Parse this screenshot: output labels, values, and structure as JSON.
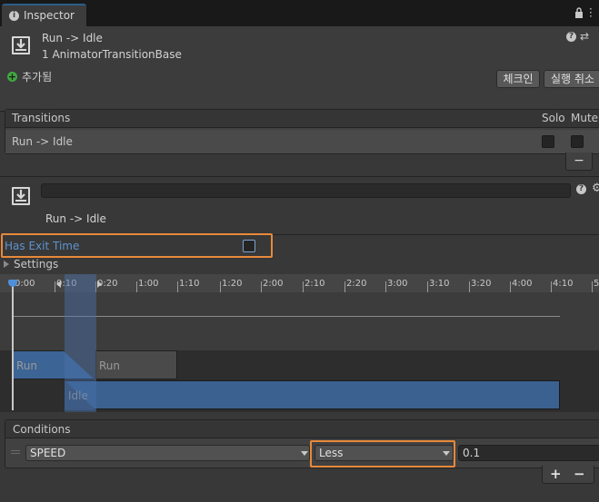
{
  "tab": {
    "label": "Inspector",
    "icon": "info-icon"
  },
  "header": {
    "title": "Run -> Idle",
    "subtitle": "1 AnimatorTransitionBase",
    "added_label": "추가됨",
    "checkin_label": "체크인",
    "revert_label": "실행 취소"
  },
  "transitions": {
    "title": "Transitions",
    "solo_label": "Solo",
    "mute_label": "Mute",
    "row_label": "Run -> Idle",
    "remove_label": "−"
  },
  "transition": {
    "name": "",
    "title": "Run -> Idle",
    "has_exit_time_label": "Has Exit Time",
    "has_exit_time": false,
    "settings_label": "Settings"
  },
  "timeline": {
    "ticks": [
      "0:00",
      "0:10",
      "0:20",
      "1:00",
      "1:10",
      "1:20",
      "2:00",
      "2:10",
      "2:20",
      "3:00",
      "3:10",
      "3:20",
      "4:00",
      "4:10",
      "5"
    ],
    "source_clip": "Run",
    "dest_clip_a": "Run",
    "dest_clip_b": "Idle"
  },
  "conditions": {
    "title": "Conditions",
    "parameter": "SPEED",
    "operator": "Less",
    "value": "0.1",
    "add_label": "+",
    "remove_label": "−"
  },
  "colors": {
    "accent": "#2c5d87",
    "highlight": "#e8893a",
    "exit_label": "#5d93cf",
    "clip_blue": "#3b6190"
  }
}
